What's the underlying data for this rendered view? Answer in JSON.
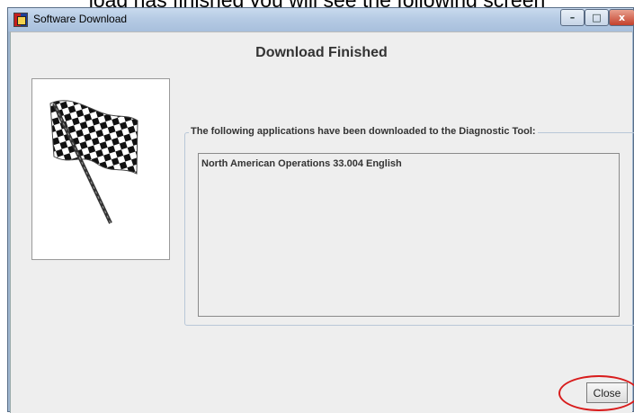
{
  "document": {
    "caption": "load has finished you will see the following screen"
  },
  "window": {
    "title": "Software Download",
    "controls": {
      "minimize": "–",
      "maximize": "□",
      "close": "x"
    }
  },
  "dialog": {
    "heading": "Download Finished",
    "group_label": "The following applications have been downloaded to the Diagnostic Tool:",
    "applications": [
      "North American Operations  33.004  English"
    ],
    "close_label": "Close"
  },
  "colors": {
    "highlight": "#d81c1c"
  }
}
